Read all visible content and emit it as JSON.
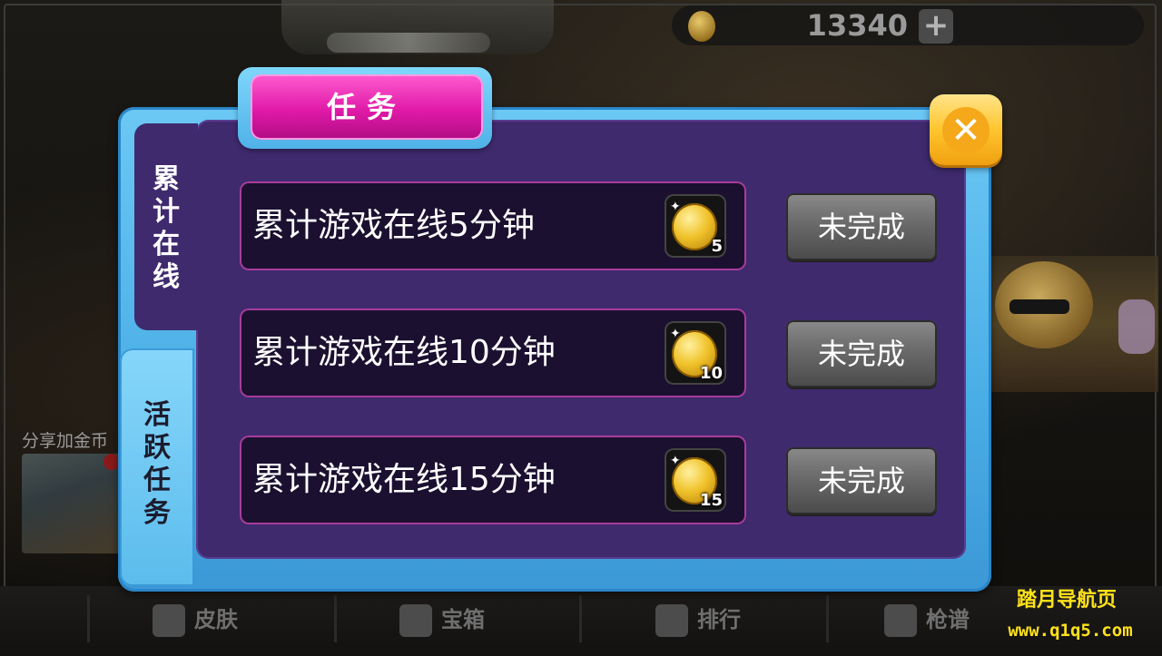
{
  "header": {
    "coin_balance": "13340",
    "add_symbol": "+"
  },
  "share": {
    "label": "分享加金币"
  },
  "dialog": {
    "title": "任务",
    "close_symbol": "✕",
    "tabs": [
      {
        "label_chars": [
          "累",
          "计",
          "在",
          "线"
        ],
        "active": true
      },
      {
        "label_chars": [
          "活",
          "跃",
          "任",
          "务"
        ],
        "active": false
      }
    ],
    "tasks": [
      {
        "text": "累计游戏在线5分钟",
        "reward": "5",
        "status": "未完成"
      },
      {
        "text": "累计游戏在线10分钟",
        "reward": "10",
        "status": "未完成"
      },
      {
        "text": "累计游戏在线15分钟",
        "reward": "15",
        "status": "未完成"
      }
    ]
  },
  "bottom_nav": {
    "items": [
      {
        "label": "皮肤",
        "icon": "jacket-icon"
      },
      {
        "label": "宝箱",
        "icon": "chest-icon"
      },
      {
        "label": "排行",
        "icon": "medal-icon"
      },
      {
        "label": "枪谱",
        "icon": "pistol-icon"
      }
    ]
  },
  "watermark": {
    "title": "踏月导航页",
    "url": "www.q1q5.com"
  },
  "colors": {
    "dialog_frame": "#4aaee6",
    "dialog_inner": "#3f2a6e",
    "title_pill": "#e01aa8",
    "close_button": "#ffc52e",
    "task_border": "#a83c9c",
    "status_button": "#6a6a6a",
    "watermark": "#ffe21a"
  }
}
